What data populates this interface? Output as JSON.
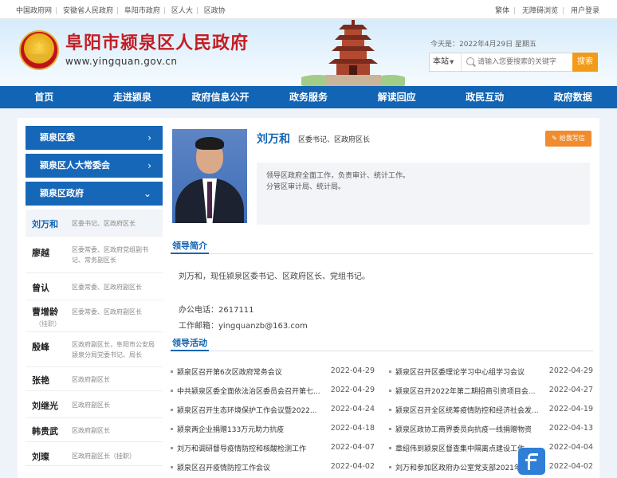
{
  "topbar": {
    "links": [
      "中国政府网",
      "安徽省人民政府",
      "阜阳市政府",
      "区人大",
      "区政协"
    ],
    "right_links": [
      "繁体",
      "无障碍浏览",
      "用户登录"
    ]
  },
  "header": {
    "site_title": "阜阳市颍泉区人民政府",
    "url": "www.yingquan.gov.cn",
    "date": "今天是：2022年4月29日 星期五"
  },
  "search": {
    "scope": "本站",
    "placeholder": "请输入您要搜索的关键字",
    "button": "搜索"
  },
  "nav": [
    "首页",
    "走进颍泉",
    "政府信息公开",
    "政务服务",
    "解读回应",
    "政民互动",
    "政府数据"
  ],
  "sidebar": {
    "groups": [
      {
        "label": "颍泉区委",
        "chevron": "›"
      },
      {
        "label": "颍泉区人大常委会",
        "chevron": "›"
      },
      {
        "label": "颍泉区政府",
        "chevron": "⌄"
      }
    ],
    "people": [
      {
        "name": "刘万和",
        "title": "区委书记、区政府区长",
        "note": ""
      },
      {
        "name": "廖越",
        "title": "区委常委、区政府党组副书记、常务副区长",
        "note": ""
      },
      {
        "name": "曾认",
        "title": "区委常委、区政府副区长",
        "note": ""
      },
      {
        "name": "曹增龄",
        "title": "区委常委、区政府副区长",
        "note": "（挂职）"
      },
      {
        "name": "殷峰",
        "title": "区政府副区长，阜阳市公安局颍泉分局党委书记、局长",
        "note": ""
      },
      {
        "name": "张艳",
        "title": "区政府副区长",
        "note": ""
      },
      {
        "name": "刘继光",
        "title": "区政府副区长",
        "note": ""
      },
      {
        "name": "韩贵武",
        "title": "区政府副区长",
        "note": ""
      },
      {
        "name": "刘璨",
        "title": "区政府副区长（挂职）",
        "note": ""
      }
    ]
  },
  "profile": {
    "name": "刘万和",
    "title": "区委书记、区政府区长",
    "write_button": "给我写信",
    "duties": [
      "领导区政府全面工作，负责审计、统计工作。",
      "分管区审计局、统计局。"
    ],
    "intro_heading": "领导简介",
    "bio": "刘万和，现任颍泉区委书记、区政府区长、党组书记。",
    "phone": "办公电话：2617111",
    "email": "工作邮箱：yingquanzb@163.com",
    "activity_heading": "领导活动"
  },
  "activities": [
    {
      "title": "颍泉区召开第6次区政府常务会议",
      "date": "2022-04-29"
    },
    {
      "title": "颍泉区召开区委理论学习中心组学习会议",
      "date": "2022-04-29"
    },
    {
      "title": "中共颍泉区委全面依法治区委员会召开第七...",
      "date": "2022-04-29"
    },
    {
      "title": "颍泉区召开2022年第二期招商引资项目会...",
      "date": "2022-04-27"
    },
    {
      "title": "颍泉区召开生态环境保护工作会议暨2022...",
      "date": "2022-04-24"
    },
    {
      "title": "颍泉区召开全区统筹疫情防控和经济社会发...",
      "date": "2022-04-19"
    },
    {
      "title": "颍泉两企业捐赠133万元助力抗疫",
      "date": "2022-04-18"
    },
    {
      "title": "颍泉区政协工商界委员向抗疫一线捐赠物资",
      "date": "2022-04-13"
    },
    {
      "title": "刘万和调研督导疫情防控和核酸检测工作",
      "date": "2022-04-07"
    },
    {
      "title": "章绍伟到颍泉区督查集中隔离点建设工作",
      "date": "2022-04-04"
    },
    {
      "title": "颍泉区召开疫情防控工作会议",
      "date": "2022-04-02"
    },
    {
      "title": "刘万和参加区政府办公室党支部2021年度...",
      "date": "2022-04-02"
    }
  ]
}
